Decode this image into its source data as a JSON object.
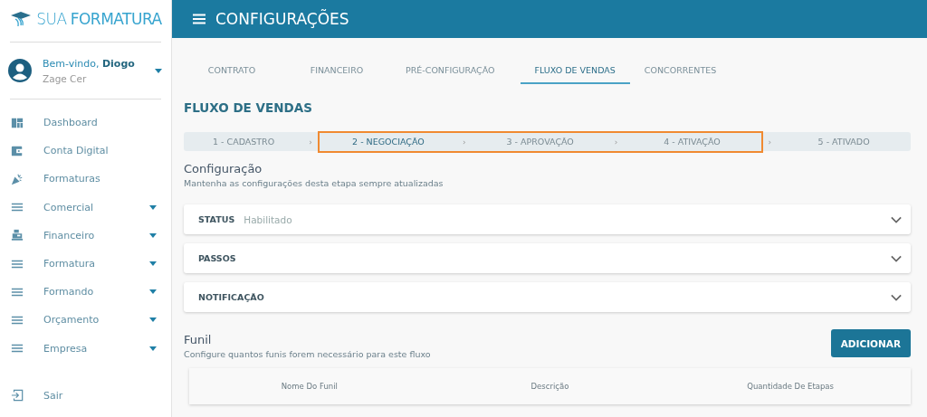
{
  "logo": {
    "text_light": "SUA",
    "text_bold": "FORMATURA"
  },
  "user": {
    "greeting": "Bem-vindo,",
    "name": "Diogo",
    "company": "Zage Cer"
  },
  "sidebar": {
    "items": [
      {
        "label": "Dashboard",
        "kind": "dashboard",
        "expandable": false
      },
      {
        "label": "Conta Digital",
        "kind": "wallet",
        "expandable": false
      },
      {
        "label": "Formaturas",
        "kind": "party",
        "expandable": false
      },
      {
        "label": "Comercial",
        "kind": "lines",
        "expandable": true
      },
      {
        "label": "Financeiro",
        "kind": "register",
        "expandable": true
      },
      {
        "label": "Formatura",
        "kind": "lines",
        "expandable": true
      },
      {
        "label": "Formando",
        "kind": "lines",
        "expandable": true
      },
      {
        "label": "Orçamento",
        "kind": "lines",
        "expandable": true
      },
      {
        "label": "Empresa",
        "kind": "lines",
        "expandable": true
      }
    ],
    "logout": "Sair"
  },
  "header": {
    "title": "CONFIGURAÇÕES"
  },
  "tabs": [
    {
      "label": "CONTRATO",
      "selected": false
    },
    {
      "label": "FINANCEIRO",
      "selected": false
    },
    {
      "label": "PRÉ-CONFIGURAÇÃO",
      "selected": false
    },
    {
      "label": "FLUXO DE VENDAS",
      "selected": true
    },
    {
      "label": "CONCORRENTES",
      "selected": false
    }
  ],
  "section_title": "FLUXO DE VENDAS",
  "steps": [
    {
      "label": "1 - CADASTRO",
      "separator": "›",
      "selected": false,
      "highlighted": false
    },
    {
      "label": "2 - NEGOCIAÇÃO",
      "separator": "›",
      "selected": true,
      "highlighted": true
    },
    {
      "label": "3 - APROVAÇÃO",
      "separator": "›",
      "selected": false,
      "highlighted": true
    },
    {
      "label": "4 - ATIVAÇÃO",
      "separator": "›",
      "selected": false,
      "highlighted": true
    },
    {
      "label": "5 - ATIVADO",
      "selected": false,
      "highlighted": false
    }
  ],
  "config": {
    "title": "Configuração",
    "subtitle": "Mantenha as configurações desta etapa sempre atualizadas"
  },
  "panels": [
    {
      "label": "STATUS",
      "value": "Habilitado",
      "expanded": false
    },
    {
      "label": "PASSOS",
      "expanded": false
    },
    {
      "label": "NOTIFICAÇÃO",
      "expanded": false
    }
  ],
  "funnel": {
    "title": "Funil",
    "subtitle": "Configure quantos funis forem necessário para este fluxo",
    "button": "ADICIONAR",
    "columns": [
      "Nome Do Funil",
      "Descrição",
      "Quantidade De Etapas"
    ]
  }
}
